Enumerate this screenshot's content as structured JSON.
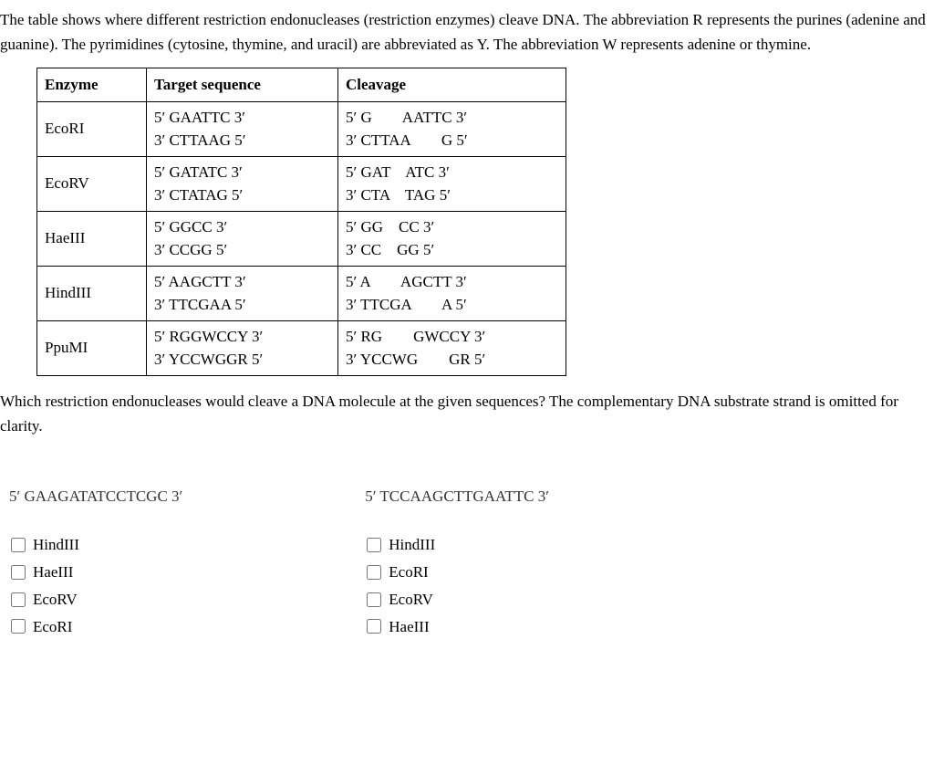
{
  "intro": "The table shows where different restriction endonucleases (restriction enzymes) cleave DNA. The abbreviation R represents the purines (adenine and guanine). The pyrimidines (cytosine, thymine, and uracil) are abbreviated as Y. The abbreviation W represents adenine or thymine.",
  "table": {
    "headers": {
      "enzyme": "Enzyme",
      "target": "Target sequence",
      "cleavage": "Cleavage"
    },
    "rows": [
      {
        "enzyme": "EcoRI",
        "target_top": "5′ GAATTC 3′",
        "target_bot": "3′ CTTAAG 5′",
        "cleave_top": "5′ G        AATTC 3′",
        "cleave_bot": "3′ CTTAA        G 5′"
      },
      {
        "enzyme": "EcoRV",
        "target_top": "5′ GATATC 3′",
        "target_bot": "3′ CTATAG 5′",
        "cleave_top": "5′ GAT    ATC 3′",
        "cleave_bot": "3′ CTA    TAG 5′"
      },
      {
        "enzyme": "HaeIII",
        "target_top": "5′ GGCC 3′",
        "target_bot": "3′ CCGG 5′",
        "cleave_top": "5′ GG    CC 3′",
        "cleave_bot": "3′ CC    GG 5′"
      },
      {
        "enzyme": "HindIII",
        "target_top": "5′ AAGCTT 3′",
        "target_bot": "3′ TTCGAA 5′",
        "cleave_top": "5′ A        AGCTT 3′",
        "cleave_bot": "3′ TTCGA        A 5′"
      },
      {
        "enzyme": "PpuMI",
        "target_top": "5′ RGGWCCY 3′",
        "target_bot": "3′ YCCWGGR 5′",
        "cleave_top": "5′ RG        GWCCY 3′",
        "cleave_bot": "3′ YCCWG        GR 5′"
      }
    ]
  },
  "question": "Which restriction endonucleases would cleave a DNA molecule at the given sequences? The complementary DNA substrate strand is omitted for clarity.",
  "sequences": [
    {
      "header": "5′ GAAGATATCCTCGC 3′",
      "options": [
        "HindIII",
        "HaeIII",
        "EcoRV",
        "EcoRI"
      ]
    },
    {
      "header": "5′ TCCAAGCTTGAATTC 3′",
      "options": [
        "HindIII",
        "EcoRI",
        "EcoRV",
        "HaeIII"
      ]
    }
  ]
}
